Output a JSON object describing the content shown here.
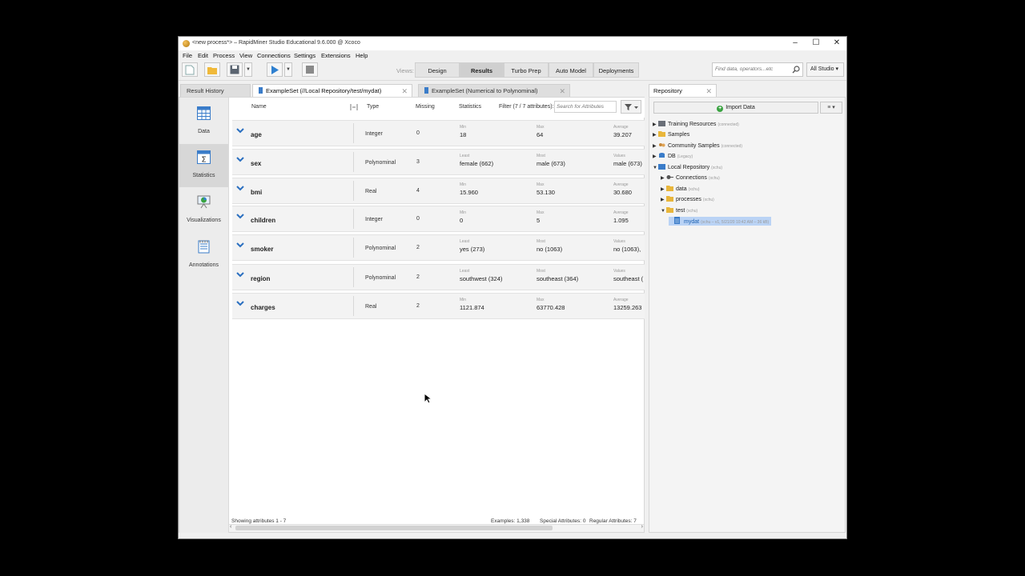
{
  "window": {
    "title": "<new process*> – RapidMiner Studio Educational 9.6.000 @ Xcoco",
    "controls": [
      "–",
      "☐",
      "✕"
    ]
  },
  "menu": [
    "File",
    "Edit",
    "Process",
    "View",
    "Connections",
    "Settings",
    "Extensions",
    "Help"
  ],
  "toolbar": {
    "views_label": "Views:",
    "views": [
      "Design",
      "Results",
      "Turbo Prep",
      "Auto Model",
      "Deployments"
    ],
    "active_view": "Results",
    "search_placeholder": "Find data, operators...etc",
    "scope_selector": "All Studio"
  },
  "result_tabs": [
    {
      "label": "Result History"
    },
    {
      "label": "ExampleSet (//Local Repository/test/mydat)"
    },
    {
      "label": "ExampleSet (Numerical to Polynominal)"
    }
  ],
  "side_nav": [
    {
      "label": "Data",
      "icon": "table-icon"
    },
    {
      "label": "Statistics",
      "icon": "statistics-icon"
    },
    {
      "label": "Visualizations",
      "icon": "visualizations-icon"
    },
    {
      "label": "Annotations",
      "icon": "annotations-icon"
    }
  ],
  "active_side_nav": "Statistics",
  "columns": {
    "name": "Name",
    "type": "Type",
    "missing": "Missing",
    "statistics": "Statistics",
    "filter": "Filter (7 / 7 attributes):",
    "filter_placeholder": "Search for Attributes"
  },
  "attributes": [
    {
      "name": "age",
      "type": "Integer",
      "missing": "0",
      "s1_label": "Min",
      "s1": "18",
      "s2_label": "Max",
      "s2": "64",
      "s3_label": "Average",
      "s3": "39.207"
    },
    {
      "name": "sex",
      "type": "Polynominal",
      "missing": "3",
      "s1_label": "Least",
      "s1": "female (662)",
      "s2_label": "Most",
      "s2": "male (673)",
      "s3_label": "Values",
      "s3": "male (673)"
    },
    {
      "name": "bmi",
      "type": "Real",
      "missing": "4",
      "s1_label": "Min",
      "s1": "15.960",
      "s2_label": "Max",
      "s2": "53.130",
      "s3_label": "Average",
      "s3": "30.680"
    },
    {
      "name": "children",
      "type": "Integer",
      "missing": "0",
      "s1_label": "Min",
      "s1": "0",
      "s2_label": "Max",
      "s2": "5",
      "s3_label": "Average",
      "s3": "1.095"
    },
    {
      "name": "smoker",
      "type": "Polynominal",
      "missing": "2",
      "s1_label": "Least",
      "s1": "yes (273)",
      "s2_label": "Most",
      "s2": "no (1063)",
      "s3_label": "Values",
      "s3": "no (1063),"
    },
    {
      "name": "region",
      "type": "Polynominal",
      "missing": "2",
      "s1_label": "Least",
      "s1": "southwest (324)",
      "s2_label": "Most",
      "s2": "southeast (364)",
      "s3_label": "Values",
      "s3": "southeast ("
    },
    {
      "name": "charges",
      "type": "Real",
      "missing": "2",
      "s1_label": "Min",
      "s1": "1121.874",
      "s2_label": "Max",
      "s2": "63770.428",
      "s3_label": "Average",
      "s3": "13259.263"
    }
  ],
  "status": {
    "showing": "Showing attributes 1 - 7",
    "examples": "Examples: 1,338",
    "special": "Special Attributes: 0",
    "regular": "Regular Attributes: 7"
  },
  "repository": {
    "tab": "Repository",
    "import_button": "Import Data",
    "menu_button": "≡ ▾",
    "tree": [
      {
        "label": "Training Resources",
        "sub": "(connected)",
        "level": 0,
        "expand": "▶",
        "icon": "server-icon"
      },
      {
        "label": "Samples",
        "sub": "",
        "level": 0,
        "expand": "▶",
        "icon": "folder-icon"
      },
      {
        "label": "Community Samples",
        "sub": "(connected)",
        "level": 0,
        "expand": "▶",
        "icon": "community-icon"
      },
      {
        "label": "DB",
        "sub": "(Legacy)",
        "level": 0,
        "expand": "▶",
        "icon": "database-icon"
      },
      {
        "label": "Local Repository",
        "sub": "(xchu)",
        "level": 0,
        "expand": "▼",
        "icon": "repository-icon"
      },
      {
        "label": "Connections",
        "sub": "(xchu)",
        "level": 1,
        "expand": "▶",
        "icon": "connections-icon"
      },
      {
        "label": "data",
        "sub": "(xchu)",
        "level": 1,
        "expand": "▶",
        "icon": "folder-icon"
      },
      {
        "label": "processes",
        "sub": "(xchu)",
        "level": 1,
        "expand": "▶",
        "icon": "folder-icon"
      },
      {
        "label": "test",
        "sub": "(xchu)",
        "level": 1,
        "expand": "▼",
        "icon": "folder-icon"
      },
      {
        "label": "mydat",
        "sub": "(xchu – v1, 5/21/20 10:42 AM – 36 kB)",
        "level": 2,
        "expand": "",
        "icon": "dataset-icon",
        "selected": true
      }
    ]
  },
  "colors": {
    "accent": "#3a7cc9",
    "chevron": "#2a6fc0",
    "selection": "#bad3f5",
    "folder": "#e9b63b"
  }
}
